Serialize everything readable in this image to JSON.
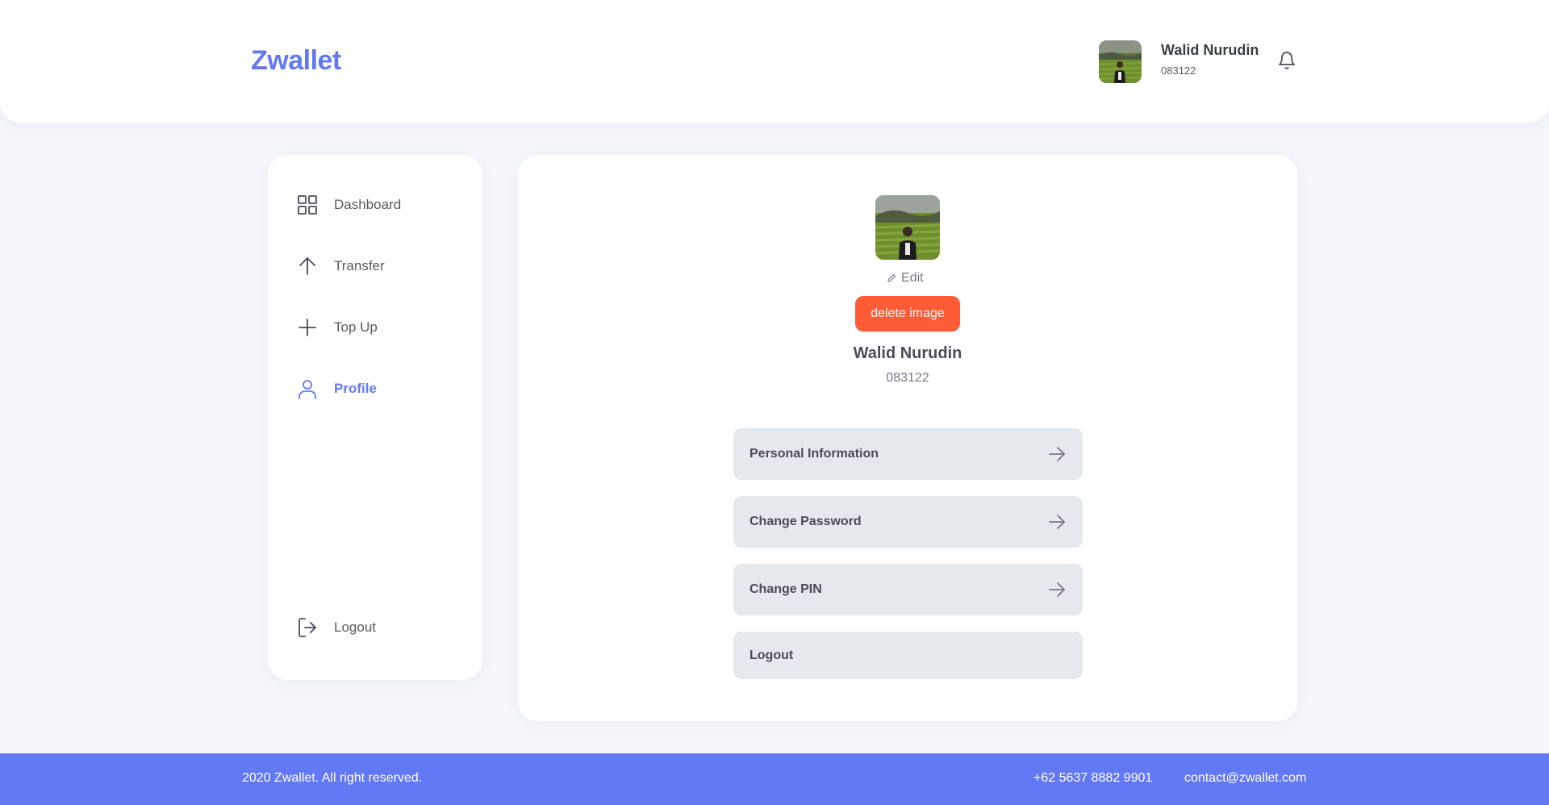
{
  "header": {
    "logo": "Zwallet",
    "user_name": "Walid Nurudin",
    "user_phone": "083122",
    "icons": {
      "notification": "bell-icon",
      "avatar": "user-photo"
    }
  },
  "sidebar": {
    "items": [
      {
        "label": "Dashboard",
        "icon": "grid-icon",
        "active": false
      },
      {
        "label": "Transfer",
        "icon": "arrow-up-icon",
        "active": false
      },
      {
        "label": "Top Up",
        "icon": "plus-icon",
        "active": false
      },
      {
        "label": "Profile",
        "icon": "user-icon",
        "active": true
      }
    ],
    "logout_label": "Logout",
    "logout_icon": "logout-icon"
  },
  "profile": {
    "edit_label": "Edit",
    "delete_image_label": "delete image",
    "name": "Walid Nurudin",
    "phone": "083122",
    "menu": [
      {
        "label": "Personal Information",
        "icon": "arrow-right-icon"
      },
      {
        "label": "Change Password",
        "icon": "arrow-right-icon"
      },
      {
        "label": "Change PIN",
        "icon": "arrow-right-icon"
      },
      {
        "label": "Logout"
      }
    ]
  },
  "footer": {
    "copyright": "2020 Zwallet. All right reserved.",
    "phone": "+62 5637 8882 9901",
    "email": "contact@zwallet.com"
  },
  "colors": {
    "primary": "#6379f4",
    "danger": "#ff5b37",
    "background": "#f5f6fc",
    "menu_row": "#e5e8ed"
  }
}
